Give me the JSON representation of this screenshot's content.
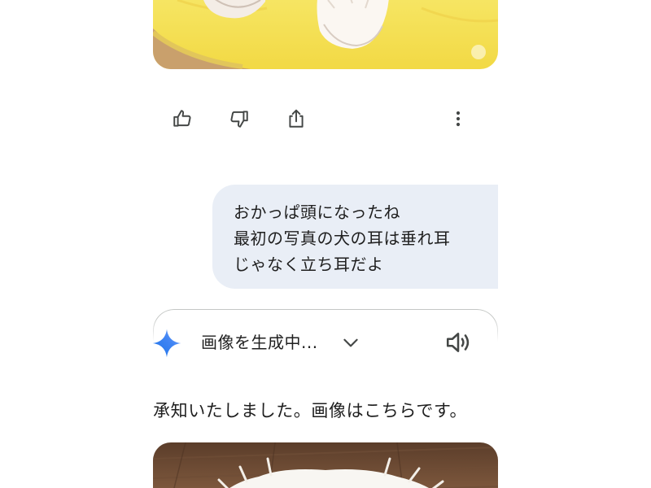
{
  "toolbar": {
    "thumbs_up_icon": "thumbs-up-icon",
    "thumbs_down_icon": "thumbs-down-icon",
    "share_icon": "share-icon",
    "more_icon": "more-vert-icon"
  },
  "user_message": {
    "lines": [
      "おかっぱ頭になったね",
      "最初の写真の犬の耳は垂れ耳",
      "じゃなく立ち耳だよ"
    ]
  },
  "assistant": {
    "status": "画像を生成中...",
    "reply": "承知いたしました。画像はこちらです。"
  },
  "colors": {
    "bubble_bg": "#e9eef6",
    "text": "#1f1f1f",
    "icon": "#444746",
    "gemini_blue": "#4285f4"
  }
}
